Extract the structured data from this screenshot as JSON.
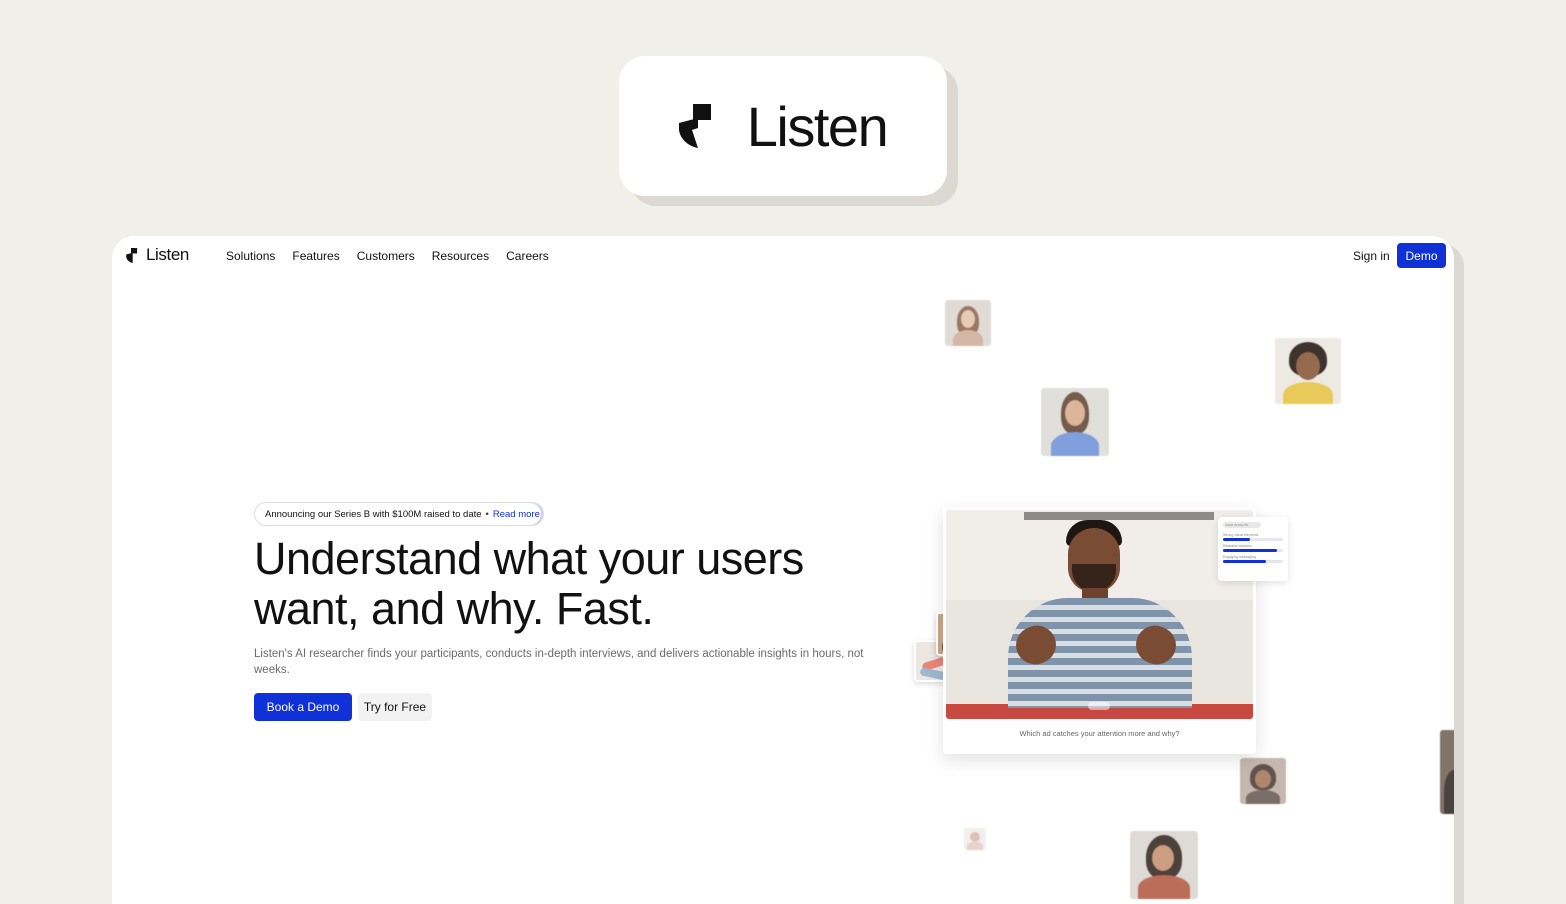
{
  "brand": {
    "name": "Listen",
    "logo_icon": "listen-mark-icon"
  },
  "nav": {
    "logo_text": "Listen",
    "links": [
      "Solutions",
      "Features",
      "Customers",
      "Resources",
      "Careers"
    ],
    "sign_in": "Sign in",
    "demo": "Demo"
  },
  "hero": {
    "announcement": "Announcing our Series B with $100M raised to date",
    "announcement_separator": "•",
    "announcement_link": "Read more",
    "headline_line1": "Understand what your users",
    "headline_line2": "want, and why. Fast.",
    "subtext": "Listen's AI researcher finds your participants, conducts in-depth interviews, and delivers actionable insights in hours, not weeks.",
    "primary_cta": "Book a Demo",
    "secondary_cta": "Try for Free"
  },
  "video_card": {
    "caption": "Which ad catches your attention more and why?",
    "insights_tag": "USER INSIGHTS",
    "insights": [
      {
        "label": "Strong visual elements",
        "value": 0.45
      },
      {
        "label": "Relatable scenario",
        "value": 0.9
      },
      {
        "label": "Engaging messaging",
        "value": 0.72
      }
    ]
  },
  "colors": {
    "accent": "#1030d8",
    "page_bg": "#f1efe9",
    "card_bg": "#ffffff"
  }
}
